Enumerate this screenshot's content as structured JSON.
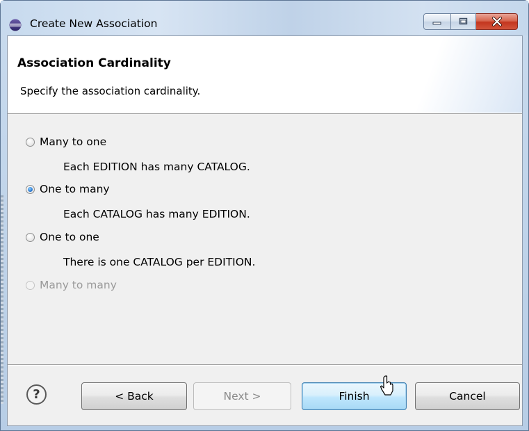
{
  "window": {
    "title": "Create New Association",
    "icon": "eclipse-icon"
  },
  "header": {
    "title": "Association Cardinality",
    "description": "Specify the association cardinality."
  },
  "options": [
    {
      "label": "Many to one",
      "description": "Each EDITION has many CATALOG.",
      "checked": false,
      "enabled": true
    },
    {
      "label": "One to many",
      "description": "Each CATALOG has many EDITION.",
      "checked": true,
      "enabled": true
    },
    {
      "label": "One to one",
      "description": "There is one CATALOG per EDITION.",
      "checked": false,
      "enabled": true
    },
    {
      "label": "Many to many",
      "description": "",
      "checked": false,
      "enabled": false
    }
  ],
  "buttons": {
    "help": "?",
    "back": "< Back",
    "next": "Next >",
    "finish": "Finish",
    "cancel": "Cancel"
  },
  "colors": {
    "accent": "#3c7fb1",
    "close": "#c4361f"
  }
}
